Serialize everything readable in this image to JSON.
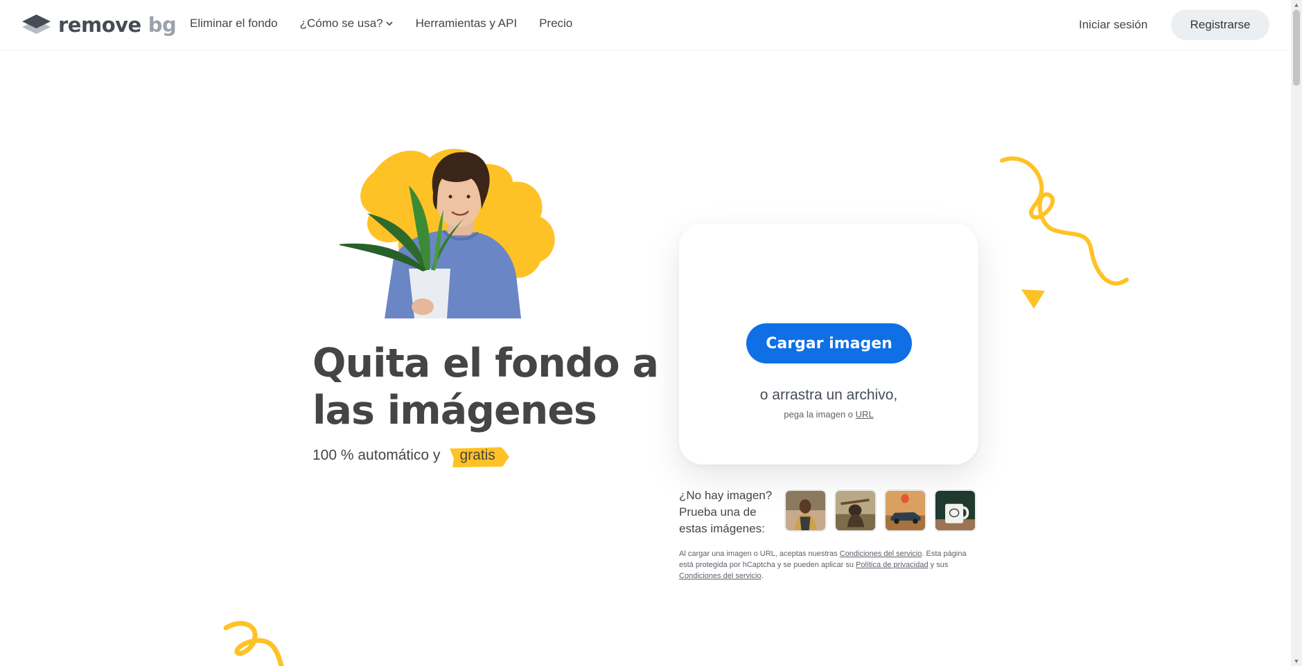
{
  "header": {
    "logo_text": "remove",
    "logo_text_bg": "bg",
    "nav": [
      {
        "label": "Eliminar el fondo"
      },
      {
        "label": "¿Cómo se usa?"
      },
      {
        "label": "Herramientas y API"
      },
      {
        "label": "Precio"
      }
    ],
    "login_label": "Iniciar sesión",
    "register_label": "Registrarse"
  },
  "hero": {
    "headline": "Quita el fondo a las imágenes",
    "subline_prefix": "100 % automático y",
    "subline_highlight": "gratis"
  },
  "upload": {
    "button_label": "Cargar imagen",
    "drop_text": "o arrastra un archivo,",
    "paste_prefix": "pega la imagen o",
    "paste_link": "URL"
  },
  "samples": {
    "label": "¿No hay imagen? Prueba una de estas imágenes:",
    "items": [
      {
        "icon": "person-sample-icon"
      },
      {
        "icon": "dog-sample-icon"
      },
      {
        "icon": "car-sample-icon"
      },
      {
        "icon": "mug-sample-icon"
      }
    ]
  },
  "legal": {
    "t1": "Al cargar una imagen o URL, aceptas nuestras",
    "link1": "Condiciones del servicio",
    "t2": ". Esta página está protegida por hCaptcha y se pueden aplicar su",
    "link2": "Política de privacidad",
    "t3": "y sus",
    "link3": "Condiciones del servicio",
    "t4": "."
  },
  "colors": {
    "accent_blue": "#0f70e6",
    "accent_yellow": "#ffc226",
    "text_dark": "#454545"
  }
}
